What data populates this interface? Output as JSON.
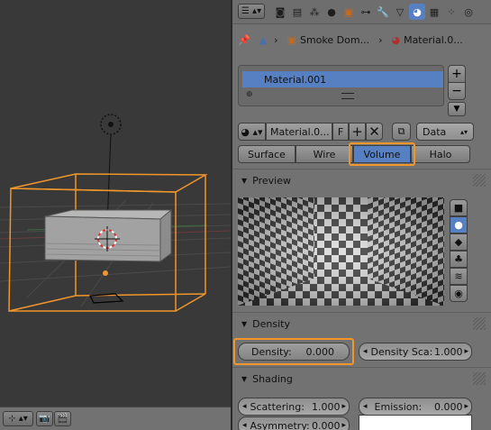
{
  "properties": {
    "breadcrumb": {
      "object": "Smoke Dom...",
      "material": "Material.0..."
    },
    "material_slots": {
      "items": [
        "Material.001"
      ],
      "add_label": "+",
      "remove_label": "−"
    },
    "material_datablock": {
      "name": "Material.0...",
      "fake_user": "F",
      "link": "Data"
    },
    "type_tabs": [
      {
        "label": "Surface",
        "active": false
      },
      {
        "label": "Wire",
        "active": false
      },
      {
        "label": "Volume",
        "active": true
      },
      {
        "label": "Halo",
        "active": false
      }
    ],
    "preview": {
      "title": "Preview"
    },
    "density": {
      "title": "Density",
      "density_label": "Density:",
      "density_value": "0.000",
      "scale_label": "Density Sca:",
      "scale_value": "1.000"
    },
    "shading": {
      "title": "Shading",
      "scattering_label": "Scattering:",
      "scattering_value": "1.000",
      "emission_label": "Emission:",
      "emission_value": "0.000",
      "asymmetry_label": "Asymmetry:",
      "asymmetry_value": "0.000"
    }
  },
  "colors": {
    "accent_blue": "#5680c2",
    "highlight_orange": "#f0962a",
    "panel_bg": "#727272",
    "viewport_bg": "#393939"
  }
}
